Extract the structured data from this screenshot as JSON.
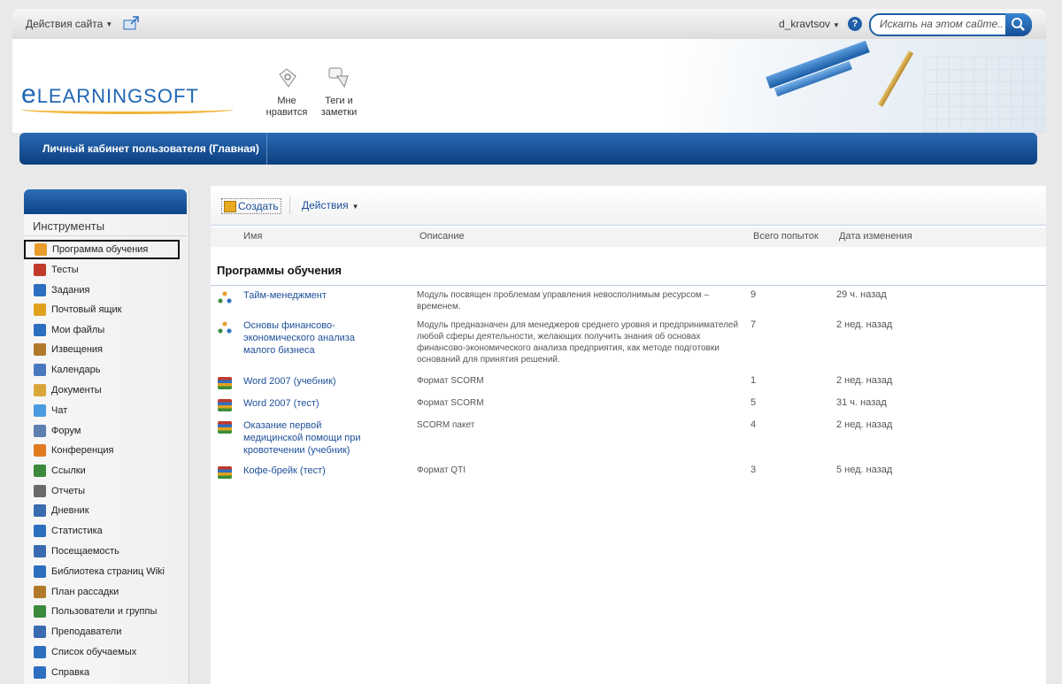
{
  "topbar": {
    "site_actions": "Действия сайта",
    "user_name": "d_kravtsov",
    "search_placeholder": "Искать на этом сайте..."
  },
  "header": {
    "logo_text": "LEARNINGSOFT",
    "logo_prefix": "e",
    "buttons": [
      {
        "label": "Мне нравится",
        "icon": "like-icon"
      },
      {
        "label": "Теги и заметки",
        "icon": "tags-notes-icon"
      }
    ]
  },
  "nav": {
    "items": [
      {
        "label": "Личный кабинет пользователя (Главная)"
      }
    ]
  },
  "sidebar": {
    "title": "Инструменты",
    "items": [
      {
        "label": "Программа обучения",
        "icon": "curriculum-icon",
        "color": "#e89c2a"
      },
      {
        "label": "Тесты",
        "icon": "tests-icon",
        "color": "#c0392b"
      },
      {
        "label": "Задания",
        "icon": "assignments-icon",
        "color": "#2d6ec0"
      },
      {
        "label": "Почтовый ящик",
        "icon": "mailbox-icon",
        "color": "#e0a21e"
      },
      {
        "label": "Мои файлы",
        "icon": "files-icon",
        "color": "#2d6ec0"
      },
      {
        "label": "Извещения",
        "icon": "announcements-icon",
        "color": "#b07a2a"
      },
      {
        "label": "Календарь",
        "icon": "calendar-icon",
        "color": "#4a78c0"
      },
      {
        "label": "Документы",
        "icon": "documents-icon",
        "color": "#d9a63a"
      },
      {
        "label": "Чат",
        "icon": "chat-icon",
        "color": "#4a9be0"
      },
      {
        "label": "Форум",
        "icon": "forum-icon",
        "color": "#5a7fb0"
      },
      {
        "label": "Конференция",
        "icon": "conference-icon",
        "color": "#e07a1e"
      },
      {
        "label": "Ссылки",
        "icon": "links-icon",
        "color": "#3c8a3c"
      },
      {
        "label": "Отчеты",
        "icon": "reports-icon",
        "color": "#6a6a6a"
      },
      {
        "label": "Дневник",
        "icon": "diary-icon",
        "color": "#3a6ab0"
      },
      {
        "label": "Статистика",
        "icon": "statistics-icon",
        "color": "#2d6ec0"
      },
      {
        "label": "Посещаемость",
        "icon": "attendance-icon",
        "color": "#3a6ab0"
      },
      {
        "label": "Библиотека страниц Wiki",
        "icon": "wiki-library-icon",
        "color": "#2d6ec0"
      },
      {
        "label": "План рассадки",
        "icon": "seating-plan-icon",
        "color": "#b07a2a"
      },
      {
        "label": "Пользователи и группы",
        "icon": "users-groups-icon",
        "color": "#3c8a3c"
      },
      {
        "label": "Преподаватели",
        "icon": "teachers-icon",
        "color": "#3a6ab0"
      },
      {
        "label": "Список обучаемых",
        "icon": "learners-list-icon",
        "color": "#2d6ec0"
      },
      {
        "label": "Справка",
        "icon": "help-icon",
        "color": "#2d6ec0"
      }
    ]
  },
  "toolbar": {
    "create_label": "Создать",
    "actions_label": "Действия"
  },
  "table": {
    "columns": {
      "name": "Имя",
      "description": "Описание",
      "attempts": "Всего попыток",
      "modified": "Дата изменения"
    },
    "group_title": "Программы обучения",
    "rows": [
      {
        "icon": "curriculum-icon",
        "name": "Тайм-менеджмент",
        "description": "Модуль посвящен проблемам управления невосполнимым ресурсом – временем.",
        "attempts": "9",
        "modified": "29 ч. назад"
      },
      {
        "icon": "curriculum-icon",
        "name": "Основы финансово-экономического анализа малого бизнеса",
        "description": "Модуль предназначен для менеджеров среднего уровня и предпринимателей любой сферы деятельности, желающих получить знания об основах финансово-экономического анализа предприятия, как методе подготовки оснований для принятия решений.",
        "attempts": "7",
        "modified": "2 нед. назад"
      },
      {
        "icon": "package-icon",
        "name": "Word 2007 (учебник)",
        "description": "Формат SCORM",
        "attempts": "1",
        "modified": "2 нед. назад"
      },
      {
        "icon": "package-icon",
        "name": "Word 2007 (тест)",
        "description": "Формат SCORM",
        "attempts": "5",
        "modified": "31 ч. назад"
      },
      {
        "icon": "package-icon",
        "name": "Оказание первой медицинской помощи при кровотечении (учебник)",
        "description": "SCORM пакет",
        "attempts": "4",
        "modified": "2 нед. назад"
      },
      {
        "icon": "package-icon",
        "name": "Кофе-брейк (тест)",
        "description": "Формат QTI",
        "attempts": "3",
        "modified": "5 нед. назад"
      }
    ]
  }
}
